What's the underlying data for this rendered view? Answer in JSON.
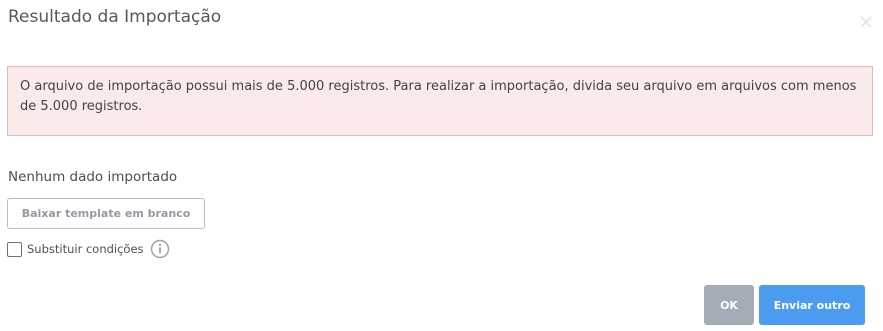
{
  "dialog": {
    "title": "Resultado da Importação",
    "close_icon": "close-icon"
  },
  "alert": {
    "message": "O arquivo de importação possui mais de 5.000 registros. Para realizar a importação, divida seu arquivo em arquivos com menos de 5.000 registros.",
    "background_color": "#fbeaea",
    "border_color": "#f0b4b5"
  },
  "result": {
    "status_text": "Nenhum dado importado",
    "download_template_label": "Baixar template em branco",
    "replace_conditions_label": "Substituir condições",
    "replace_conditions_checked": false,
    "info_icon": "info-icon"
  },
  "footer": {
    "ok_label": "OK",
    "send_another_label": "Enviar outro",
    "ok_color": "#a4acb8",
    "send_another_color": "#4b9bf1"
  }
}
